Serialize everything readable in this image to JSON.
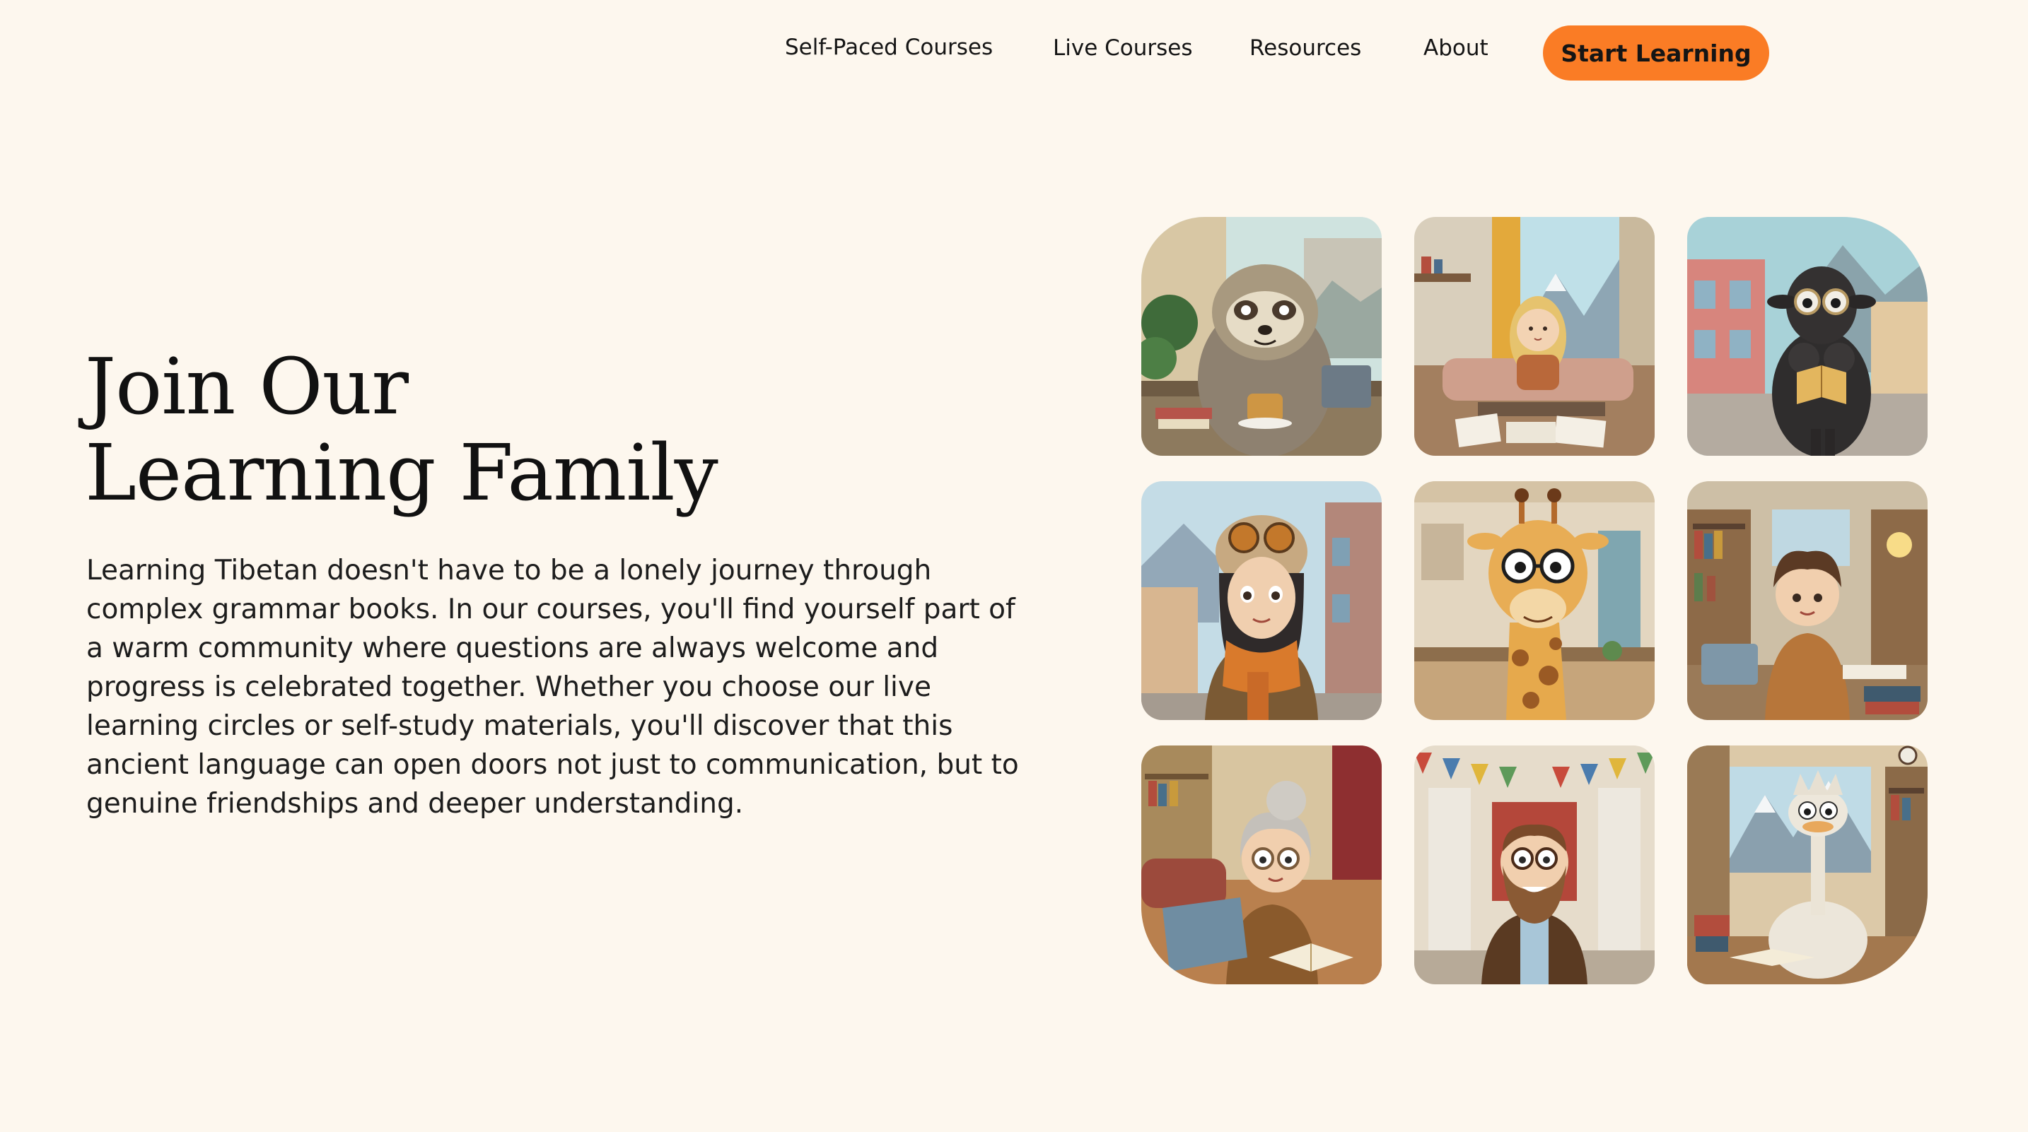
{
  "nav": {
    "links": [
      {
        "label": "Self-Paced Courses"
      },
      {
        "label": "Live Courses"
      },
      {
        "label": "Resources"
      },
      {
        "label": "About"
      }
    ],
    "cta_label": "Start Learning"
  },
  "hero": {
    "title_line1": "Join Our",
    "title_line2": "Learning Family",
    "body": "Learning Tibetan doesn't have to be a lonely journey through complex grammar books. In our courses, you'll find yourself part of a warm community where questions are always welcome and progress is celebrated together. Whether you choose our live learning circles or self-study materials, you'll discover that this ancient language can open doors not just to communication, but to genuine friendships and deeper understanding."
  },
  "gallery": {
    "tiles": [
      {
        "subject": "sloth-with-tea"
      },
      {
        "subject": "girl-studying-papers"
      },
      {
        "subject": "black-sheep-reading"
      },
      {
        "subject": "girl-with-goggles"
      },
      {
        "subject": "giraffe-with-glasses"
      },
      {
        "subject": "boy-with-laptop"
      },
      {
        "subject": "grandmother-with-laptop"
      },
      {
        "subject": "bearded-man-with-flags"
      },
      {
        "subject": "ostrich-with-book"
      }
    ]
  },
  "colors": {
    "background": "#fdf7ee",
    "accent": "#fa7c25",
    "text": "#141414"
  }
}
